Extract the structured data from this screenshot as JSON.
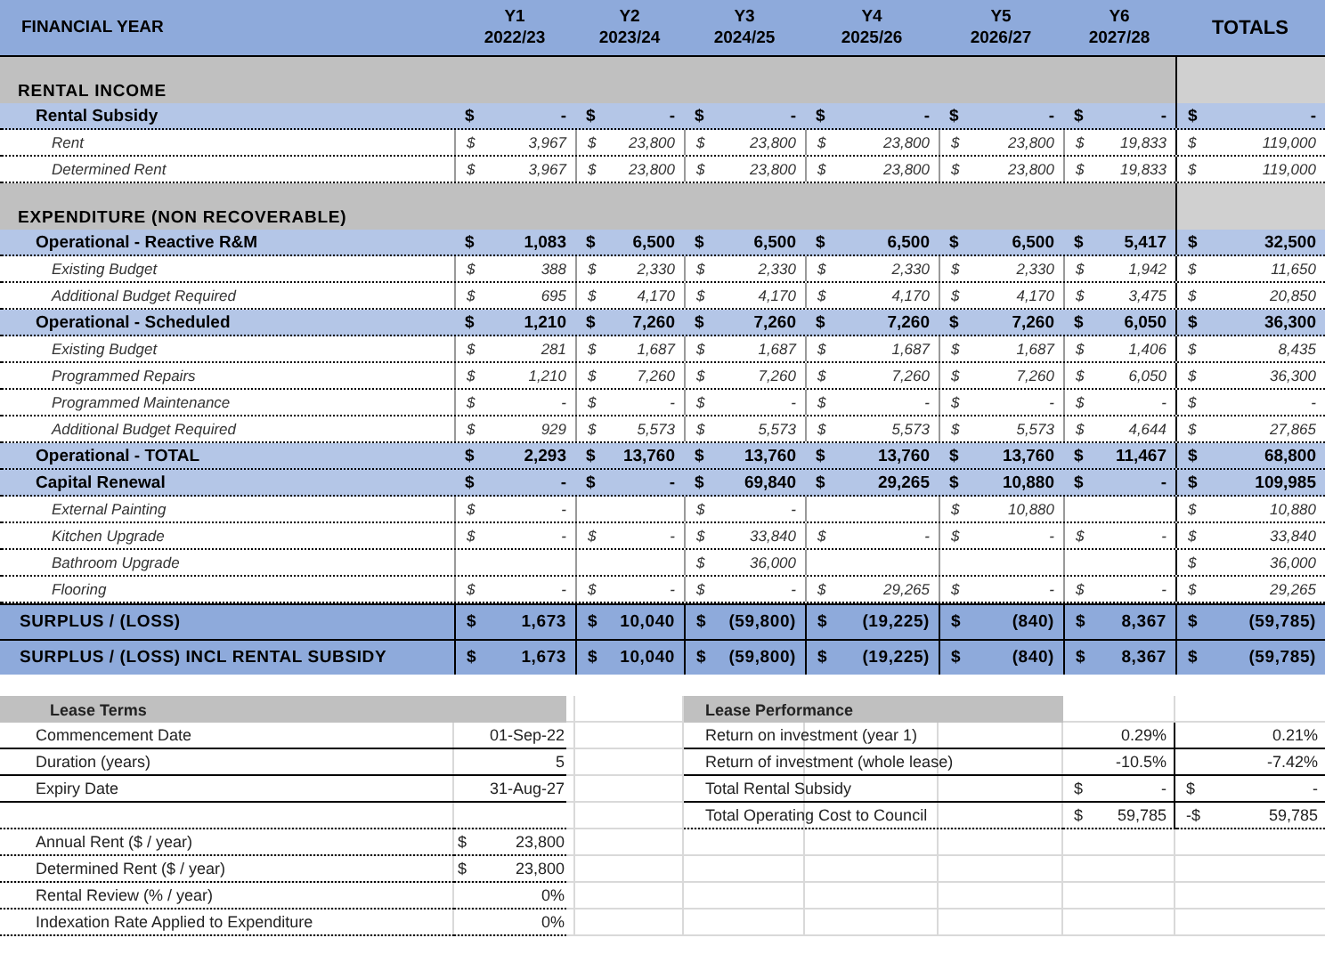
{
  "header": {
    "label": "FINANCIAL YEAR",
    "years": [
      {
        "year": "Y1",
        "period": "2022/23"
      },
      {
        "year": "Y2",
        "period": "2023/24"
      },
      {
        "year": "Y3",
        "period": "2024/25"
      },
      {
        "year": "Y4",
        "period": "2025/26"
      },
      {
        "year": "Y5",
        "period": "2026/27"
      },
      {
        "year": "Y6",
        "period": "2027/28"
      }
    ],
    "totals": "TOTALS"
  },
  "rows": [
    {
      "kind": "section",
      "label": "RENTAL INCOME"
    },
    {
      "kind": "group",
      "label": "Rental Subsidy",
      "cells": [
        [
          "$",
          "-"
        ],
        [
          "$",
          "-"
        ],
        [
          "$",
          "-"
        ],
        [
          "$",
          "-"
        ],
        [
          "$",
          "-"
        ],
        [
          "$",
          "-"
        ],
        [
          "$",
          "-"
        ]
      ]
    },
    {
      "kind": "item",
      "label": "Rent",
      "cells": [
        [
          "$",
          "3,967"
        ],
        [
          "$",
          "23,800"
        ],
        [
          "$",
          "23,800"
        ],
        [
          "$",
          "23,800"
        ],
        [
          "$",
          "23,800"
        ],
        [
          "$",
          "19,833"
        ],
        [
          "$",
          "119,000"
        ]
      ]
    },
    {
      "kind": "item",
      "label": "Determined Rent",
      "cells": [
        [
          "$",
          "3,967"
        ],
        [
          "$",
          "23,800"
        ],
        [
          "$",
          "23,800"
        ],
        [
          "$",
          "23,800"
        ],
        [
          "$",
          "23,800"
        ],
        [
          "$",
          "19,833"
        ],
        [
          "$",
          "119,000"
        ]
      ]
    },
    {
      "kind": "section",
      "label": "EXPENDITURE (NON RECOVERABLE)"
    },
    {
      "kind": "group",
      "label": "Operational - Reactive R&M",
      "cells": [
        [
          "$",
          "1,083"
        ],
        [
          "$",
          "6,500"
        ],
        [
          "$",
          "6,500"
        ],
        [
          "$",
          "6,500"
        ],
        [
          "$",
          "6,500"
        ],
        [
          "$",
          "5,417"
        ],
        [
          "$",
          "32,500"
        ]
      ]
    },
    {
      "kind": "item",
      "label": "Existing Budget",
      "cells": [
        [
          "$",
          "388"
        ],
        [
          "$",
          "2,330"
        ],
        [
          "$",
          "2,330"
        ],
        [
          "$",
          "2,330"
        ],
        [
          "$",
          "2,330"
        ],
        [
          "$",
          "1,942"
        ],
        [
          "$",
          "11,650"
        ]
      ]
    },
    {
      "kind": "item",
      "label": "Additional Budget Required",
      "cells": [
        [
          "$",
          "695"
        ],
        [
          "$",
          "4,170"
        ],
        [
          "$",
          "4,170"
        ],
        [
          "$",
          "4,170"
        ],
        [
          "$",
          "4,170"
        ],
        [
          "$",
          "3,475"
        ],
        [
          "$",
          "20,850"
        ]
      ]
    },
    {
      "kind": "group",
      "label": "Operational - Scheduled",
      "cells": [
        [
          "$",
          "1,210"
        ],
        [
          "$",
          "7,260"
        ],
        [
          "$",
          "7,260"
        ],
        [
          "$",
          "7,260"
        ],
        [
          "$",
          "7,260"
        ],
        [
          "$",
          "6,050"
        ],
        [
          "$",
          "36,300"
        ]
      ]
    },
    {
      "kind": "item",
      "label": "Existing Budget",
      "cells": [
        [
          "$",
          "281"
        ],
        [
          "$",
          "1,687"
        ],
        [
          "$",
          "1,687"
        ],
        [
          "$",
          "1,687"
        ],
        [
          "$",
          "1,687"
        ],
        [
          "$",
          "1,406"
        ],
        [
          "$",
          "8,435"
        ]
      ]
    },
    {
      "kind": "item",
      "label": "Programmed Repairs",
      "cells": [
        [
          "$",
          "1,210"
        ],
        [
          "$",
          "7,260"
        ],
        [
          "$",
          "7,260"
        ],
        [
          "$",
          "7,260"
        ],
        [
          "$",
          "7,260"
        ],
        [
          "$",
          "6,050"
        ],
        [
          "$",
          "36,300"
        ]
      ]
    },
    {
      "kind": "item",
      "label": "Programmed Maintenance",
      "cells": [
        [
          "$",
          "-"
        ],
        [
          "$",
          "-"
        ],
        [
          "$",
          "-"
        ],
        [
          "$",
          "-"
        ],
        [
          "$",
          "-"
        ],
        [
          "$",
          "-"
        ],
        [
          "$",
          "-"
        ]
      ]
    },
    {
      "kind": "item",
      "label": "Additional Budget Required",
      "cells": [
        [
          "$",
          "929"
        ],
        [
          "$",
          "5,573"
        ],
        [
          "$",
          "5,573"
        ],
        [
          "$",
          "5,573"
        ],
        [
          "$",
          "5,573"
        ],
        [
          "$",
          "4,644"
        ],
        [
          "$",
          "27,865"
        ]
      ]
    },
    {
      "kind": "group",
      "label": "Operational - TOTAL",
      "cells": [
        [
          "$",
          "2,293"
        ],
        [
          "$",
          "13,760"
        ],
        [
          "$",
          "13,760"
        ],
        [
          "$",
          "13,760"
        ],
        [
          "$",
          "13,760"
        ],
        [
          "$",
          "11,467"
        ],
        [
          "$",
          "68,800"
        ]
      ]
    },
    {
      "kind": "group",
      "label": "Capital Renewal",
      "cells": [
        [
          "$",
          "-"
        ],
        [
          "$",
          "-"
        ],
        [
          "$",
          "69,840"
        ],
        [
          "$",
          "29,265"
        ],
        [
          "$",
          "10,880"
        ],
        [
          "$",
          "-"
        ],
        [
          "$",
          "109,985"
        ]
      ]
    },
    {
      "kind": "item",
      "label": "External Painting",
      "cells": [
        [
          "$",
          "-"
        ],
        null,
        [
          "$",
          "-"
        ],
        null,
        [
          "$",
          "10,880"
        ],
        null,
        [
          "$",
          "10,880"
        ]
      ]
    },
    {
      "kind": "item",
      "label": "Kitchen Upgrade",
      "cells": [
        [
          "$",
          "-"
        ],
        [
          "$",
          "-"
        ],
        [
          "$",
          "33,840"
        ],
        [
          "$",
          "-"
        ],
        [
          "$",
          "-"
        ],
        [
          "$",
          "-"
        ],
        [
          "$",
          "33,840"
        ]
      ]
    },
    {
      "kind": "item",
      "label": "Bathroom  Upgrade",
      "cells": [
        null,
        null,
        [
          "$",
          "36,000"
        ],
        null,
        null,
        null,
        [
          "$",
          "36,000"
        ]
      ]
    },
    {
      "kind": "item",
      "label": "Flooring",
      "cells": [
        [
          "$",
          "-"
        ],
        [
          "$",
          "-"
        ],
        [
          "$",
          "-"
        ],
        [
          "$",
          "29,265"
        ],
        [
          "$",
          "-"
        ],
        [
          "$",
          "-"
        ],
        [
          "$",
          "29,265"
        ]
      ]
    },
    {
      "kind": "surplus",
      "label": "SURPLUS / (LOSS)",
      "cells": [
        [
          "$",
          "1,673"
        ],
        [
          "$",
          "10,040"
        ],
        [
          "$",
          "(59,800)"
        ],
        [
          "$",
          "(19,225)"
        ],
        [
          "$",
          "(840)"
        ],
        [
          "$",
          "8,367"
        ],
        [
          "$",
          "(59,785)"
        ]
      ]
    },
    {
      "kind": "surplus",
      "label": "SURPLUS / (LOSS) INCL RENTAL SUBSIDY",
      "cells": [
        [
          "$",
          "1,673"
        ],
        [
          "$",
          "10,040"
        ],
        [
          "$",
          "(59,800)"
        ],
        [
          "$",
          "(19,225)"
        ],
        [
          "$",
          "(840)"
        ],
        [
          "$",
          "8,367"
        ],
        [
          "$",
          "(59,785)"
        ]
      ]
    }
  ],
  "lease_terms": {
    "title": "Lease Terms",
    "rows": [
      {
        "kind": "row",
        "label": "Commencement Date",
        "value": "01-Sep-22"
      },
      {
        "kind": "row",
        "label": "Duration (years)",
        "value": "5"
      },
      {
        "kind": "row",
        "label": "Expiry Date",
        "value": "31-Aug-27"
      },
      {
        "kind": "spacer"
      },
      {
        "kind": "row",
        "label": "Annual Rent  ($ / year)",
        "currency": "$",
        "value": "23,800"
      },
      {
        "kind": "row",
        "label": "Determined Rent ($ / year)",
        "currency": "$",
        "value": "23,800"
      },
      {
        "kind": "row",
        "label": "Rental Review (% / year)",
        "value": "0%"
      },
      {
        "kind": "row",
        "label": "Indexation Rate Applied to Expenditure",
        "value": "0%"
      }
    ]
  },
  "lease_performance": {
    "title": "Lease Performance",
    "rows": [
      {
        "label": "Return on investment (year 1)",
        "values": [
          {
            "value": "0.29%"
          },
          {
            "value": "0.21%"
          }
        ]
      },
      {
        "label": "Return of investment (whole lease)",
        "values": [
          {
            "value": "-10.5%"
          },
          {
            "value": "-7.42%"
          }
        ]
      },
      {
        "label": "Total Rental Subsidy",
        "values": [
          {
            "currency": "$",
            "value": "-"
          },
          {
            "currency": "$",
            "value": "-"
          }
        ]
      },
      {
        "label": "Total Operating Cost to Council",
        "values": [
          {
            "currency": "$",
            "value": "59,785"
          },
          {
            "currency": "-$",
            "value": "59,785"
          }
        ]
      }
    ]
  }
}
